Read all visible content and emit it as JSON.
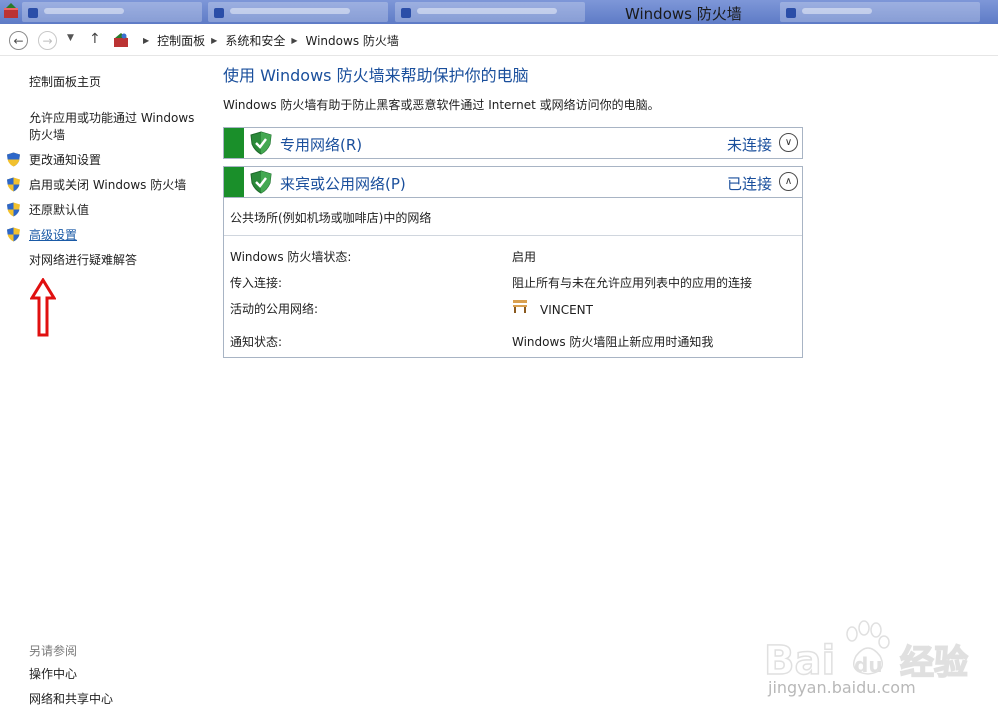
{
  "window": {
    "title": "Windows 防火墙"
  },
  "breadcrumb": {
    "items": [
      "控制面板",
      "系统和安全",
      "Windows 防火墙"
    ]
  },
  "sidebar": {
    "home": "控制面板主页",
    "items": [
      {
        "label": "允许应用或功能通过 Windows 防火墙",
        "shield": false
      },
      {
        "label": "更改通知设置",
        "shield": true
      },
      {
        "label": "启用或关闭 Windows 防火墙",
        "shield": true
      },
      {
        "label": "还原默认值",
        "shield": true
      },
      {
        "label": "高级设置",
        "shield": true
      },
      {
        "label": "对网络进行疑难解答",
        "shield": false
      }
    ],
    "see_also_label": "另请参阅",
    "see_also": [
      "操作中心",
      "网络和共享中心"
    ]
  },
  "main": {
    "title": "使用 Windows 防火墙来帮助保护你的电脑",
    "description": "Windows 防火墙有助于防止黑客或恶意软件通过 Internet 或网络访问你的电脑。",
    "networks": [
      {
        "label": "专用网络(R)",
        "status": "未连接",
        "expanded": false
      },
      {
        "label": "来宾或公用网络(P)",
        "status": "已连接",
        "expanded": true
      }
    ],
    "panel": {
      "description": "公共场所(例如机场或咖啡店)中的网络",
      "properties": [
        {
          "label": "Windows 防火墙状态:",
          "value": "启用"
        },
        {
          "label": "传入连接:",
          "value": "阻止所有与未在允许应用列表中的应用的连接"
        },
        {
          "label": "活动的公用网络:",
          "value": "VINCENT"
        },
        {
          "label": "通知状态:",
          "value": "Windows 防火墙阻止新应用时通知我"
        }
      ]
    }
  },
  "colors": {
    "link_blue": "#1a4f9c",
    "header_green": "#1a8f2a",
    "annotation_red": "#e01010"
  },
  "watermark": {
    "logo_text": "Bai du 经验",
    "url": "jingyan.baidu.com"
  }
}
